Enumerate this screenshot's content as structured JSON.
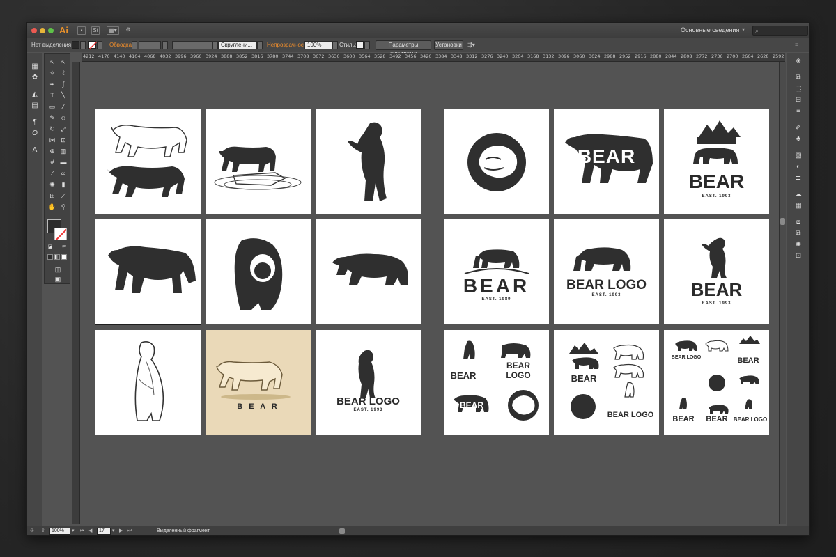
{
  "app": {
    "logo": "Ai",
    "workspace": "Основные сведения",
    "arrange_badge": "St"
  },
  "controlbar": {
    "selection": "Нет выделения",
    "stroke_label": "Обводка:",
    "brush_label": "Скруглени...",
    "opacity_label": "Непрозрачность:",
    "opacity_value": "100%",
    "style_label": "Стиль:",
    "doc_settings": "Параметры документа",
    "preferences": "Установки"
  },
  "ruler": {
    "h_ticks": [
      "4212",
      "4176",
      "4140",
      "4104",
      "4068",
      "4032",
      "3996",
      "3960",
      "3924",
      "3888",
      "3852",
      "3816",
      "3780",
      "3744",
      "3708",
      "3672",
      "3636",
      "3600",
      "3564",
      "3528",
      "3492",
      "3456",
      "3420",
      "3384",
      "3348",
      "3312",
      "3276",
      "3240",
      "3204",
      "3168",
      "3132",
      "3096",
      "3060",
      "3024",
      "2988",
      "2952",
      "2916",
      "2880",
      "2844",
      "2808",
      "2772",
      "2736",
      "2700",
      "2664",
      "2628",
      "2592"
    ]
  },
  "statusbar": {
    "zoom": "100%",
    "artboard_number": "17",
    "status_text": "Выделенный фрагмент"
  },
  "artboards": {
    "bear_word": "BEAR",
    "bear_logo": "BEAR LOGO",
    "est_1993": "EAST. 1993",
    "est_1989": "EAST. 1989",
    "bear_spaced": "B E A R"
  },
  "colors": {
    "app_bg": "#535353",
    "panel": "#464646",
    "accent_orange": "#f08e2c",
    "ink": "#2a2a2a",
    "beige": "#ead9b8"
  }
}
